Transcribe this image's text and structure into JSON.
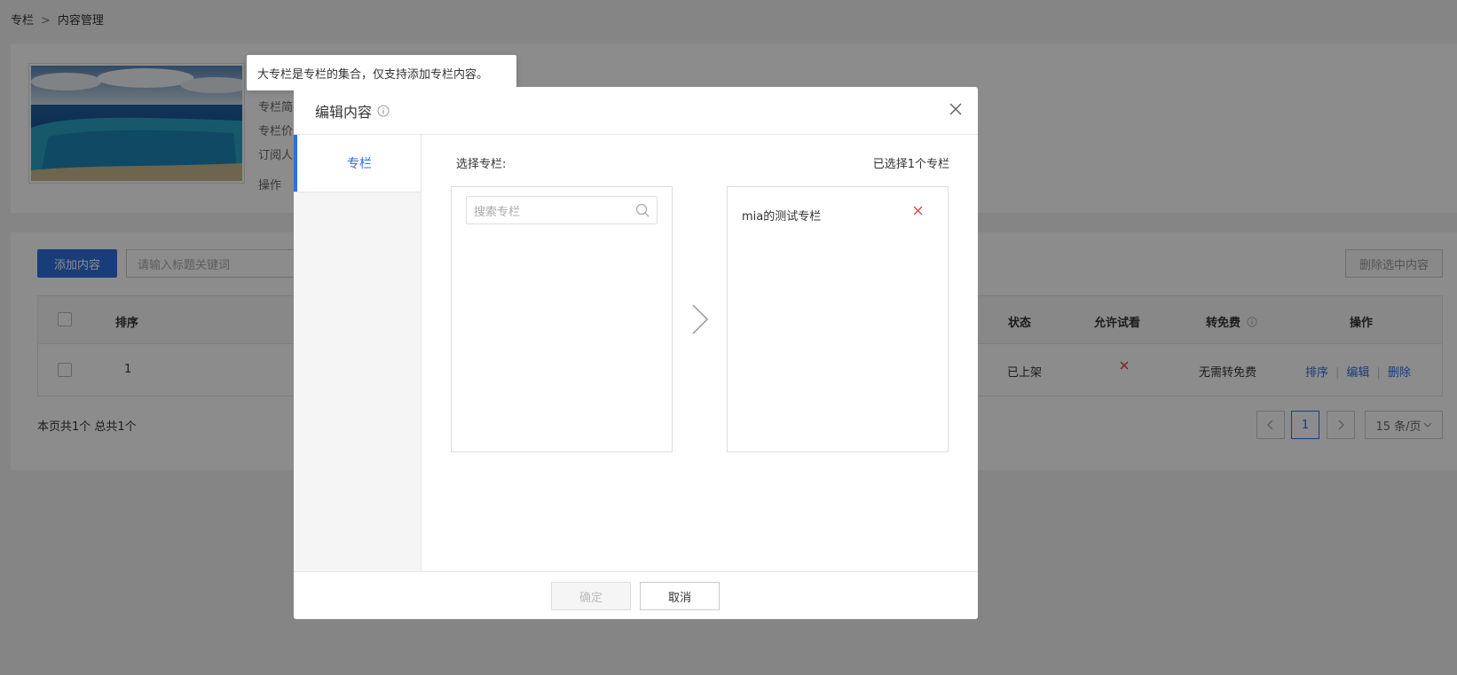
{
  "breadcrumb": {
    "root": "专栏",
    "separator": ">",
    "current": "内容管理"
  },
  "column_info": {
    "lines": [
      "专栏简",
      "专栏价",
      "订阅人",
      "操作"
    ]
  },
  "toolbar": {
    "add_label": "添加内容",
    "search_placeholder": "请输入标题关键词",
    "delete_selected_label": "删除选中内容"
  },
  "table": {
    "headers": {
      "order": "排序",
      "status": "状态",
      "allow_preview": "允许试看",
      "to_free": "转免费",
      "actions": "操作"
    },
    "rows": [
      {
        "order": "1",
        "status": "已上架",
        "allow_preview_icon": "red-x-icon",
        "to_free": "无需转免费",
        "action_sort": "排序",
        "action_edit": "编辑",
        "action_delete": "删除"
      }
    ]
  },
  "pagination": {
    "summary": "本页共1个 总共1个",
    "current_page": "1",
    "page_size": "15 条/页"
  },
  "tooltip": {
    "text": "大专栏是专栏的集合，仅支持添加专栏内容。"
  },
  "modal": {
    "title": "编辑内容",
    "tab": "专栏",
    "choose_label": "选择专栏:",
    "selected_count_label": "已选择1个专栏",
    "search_placeholder": "搜索专栏",
    "selected_items": [
      "mia的测试专栏"
    ],
    "confirm_label": "确定",
    "cancel_label": "取消"
  },
  "colors": {
    "accent": "#2f6fe0",
    "danger": "#e0404a"
  }
}
